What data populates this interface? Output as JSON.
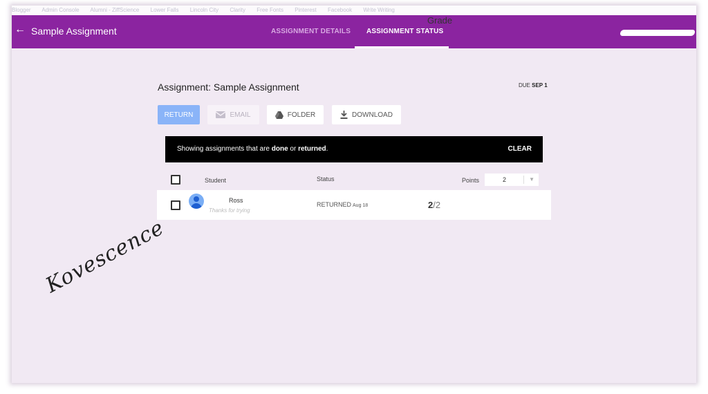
{
  "browser": {
    "bookmarks": [
      "Blogger",
      "Admin Console",
      "Alumni - ZiffScience",
      "Lower Falls",
      "Lincoln City",
      "Clarity",
      "Free Fonts",
      "Pinterest",
      "Facebook",
      "Write Writing"
    ]
  },
  "header": {
    "back_icon": "arrow-left-icon",
    "title": "Sample Assignment",
    "tabs": [
      {
        "label": "ASSIGNMENT DETAILS",
        "active": false
      },
      {
        "label": "ASSIGNMENT STATUS",
        "active": true
      }
    ],
    "accent_color": "#8b24a0"
  },
  "assignment": {
    "heading": "Assignment: Sample Assignment",
    "due_prefix": "DUE",
    "due_date": "SEP 1"
  },
  "toolbar": {
    "return_label": "RETURN",
    "email_label": "EMAIL",
    "folder_label": "FOLDER",
    "download_label": "DOWNLOAD",
    "return_color": "#8ab4f8"
  },
  "banner": {
    "prefix": "Showing assignments that are ",
    "done": "done",
    "or": " or ",
    "returned": "returned",
    "suffix": ".",
    "clear_label": "CLEAR"
  },
  "table": {
    "headers": {
      "student": "Student",
      "status": "Status",
      "grade": "Grade",
      "points": "Points"
    },
    "points_value": "2",
    "rows": [
      {
        "name": "Ross",
        "note": "Thanks for trying",
        "status": "RETURNED",
        "status_date": "Aug 18",
        "grade": "2",
        "grade_total": "/2"
      }
    ]
  },
  "watermark": {
    "text": "Kovescence"
  }
}
